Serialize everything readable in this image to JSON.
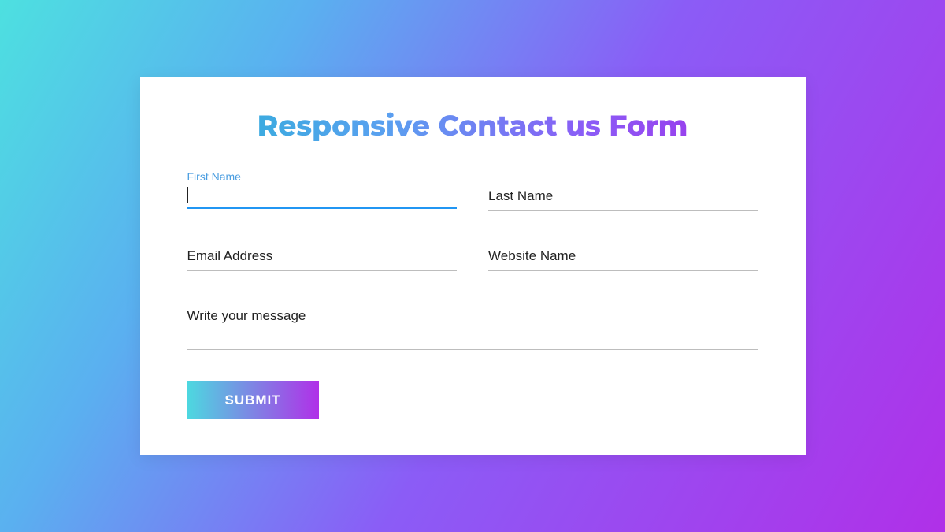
{
  "form": {
    "title": "Responsive Contact us Form",
    "fields": {
      "first_name": {
        "label": "First Name",
        "value": ""
      },
      "last_name": {
        "label": "Last Name",
        "value": ""
      },
      "email": {
        "label": "Email Address",
        "value": ""
      },
      "website": {
        "label": "Website Name",
        "value": ""
      },
      "message": {
        "label": "Write your message",
        "value": ""
      }
    },
    "submit_label": "SUBMIT"
  },
  "colors": {
    "gradient_start": "#4dd8e0",
    "gradient_end": "#b030e8",
    "focus_border": "#2196f3",
    "floated_label": "#4a9de0"
  }
}
